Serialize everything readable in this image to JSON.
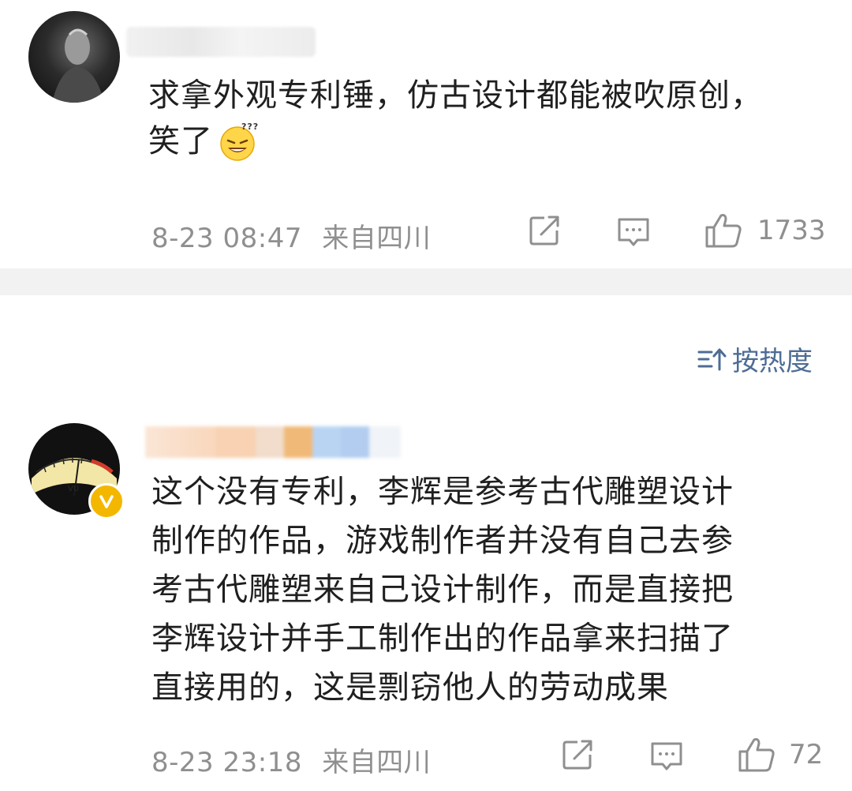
{
  "comments": [
    {
      "text_line1": "求拿外观专利锤，仿古设计都能被吹原创，",
      "text_line2": "笑了",
      "timestamp": "8-23 08:47",
      "location": "来自四川",
      "likes": "1733",
      "emoji": "dizzy-grin-emoji"
    },
    {
      "lines": [
        "这个没有专利，李辉是参考古代雕塑设计",
        "制作的作品，游戏制作者并没有自己去参",
        "考古代雕塑来自己设计制作，而是直接把",
        "李辉设计并手工制作出的作品拿来扫描了",
        "直接用的，这是剽窃他人的劳动成果"
      ],
      "timestamp": "8-23 23:18",
      "location": "来自四川",
      "likes": "72",
      "verified": true
    }
  ],
  "sort": {
    "label": "按热度",
    "icon": "sort-icon"
  },
  "icons": {
    "share": "share-icon",
    "comment": "comment-icon",
    "like": "thumbs-up-icon"
  },
  "colors": {
    "meta_gray": "#8f8f8f",
    "link_blue": "#4d6c94",
    "divider": "#f2f2f2",
    "verified_gold": "#f4b700"
  }
}
